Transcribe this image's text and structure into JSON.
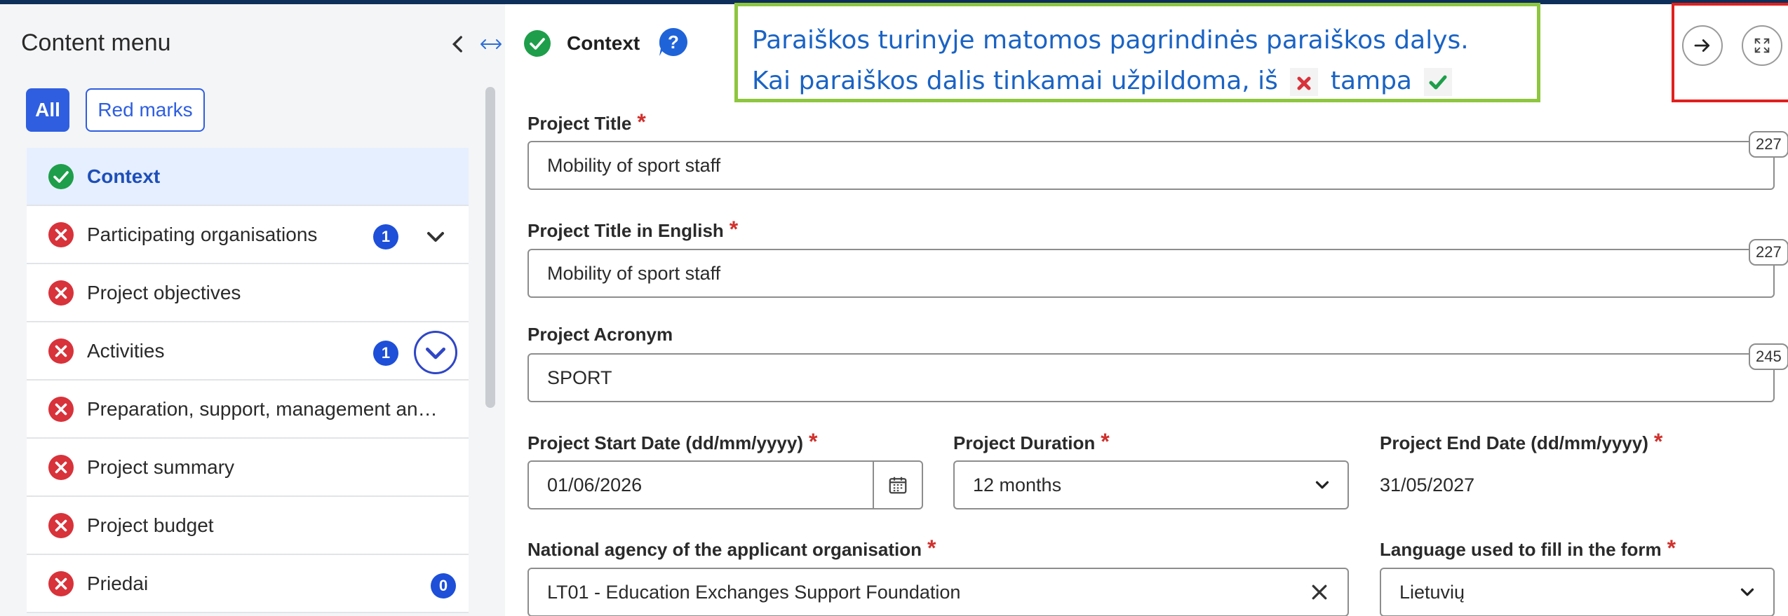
{
  "sidebar": {
    "title": "Content menu",
    "filters": {
      "all": "All",
      "red_marks": "Red marks"
    },
    "items": [
      {
        "label": "Context",
        "status": "complete"
      },
      {
        "label": "Participating organisations",
        "status": "error",
        "badge": "1"
      },
      {
        "label": "Project objectives",
        "status": "error"
      },
      {
        "label": "Activities",
        "status": "error",
        "badge": "1"
      },
      {
        "label": "Preparation, support, management an…",
        "status": "error"
      },
      {
        "label": "Project summary",
        "status": "error"
      },
      {
        "label": "Project budget",
        "status": "error"
      },
      {
        "label": "Priedai",
        "status": "error",
        "badge": "0"
      }
    ]
  },
  "header": {
    "title": "Context"
  },
  "tooltip": {
    "line1": "Paraiškos turinyje matomos pagrindinės paraiškos dalys.",
    "line2_start": "Kai paraiškos dalis tinkamai užpildoma, iš",
    "line2_mid": "tampa"
  },
  "form": {
    "project_title": {
      "label": "Project Title",
      "value": "Mobility of sport staff",
      "counter": "227"
    },
    "project_title_en": {
      "label": "Project Title in English",
      "value": "Mobility of sport staff",
      "counter": "227"
    },
    "project_acronym": {
      "label": "Project Acronym",
      "value": "SPORT",
      "counter": "245"
    },
    "start_date": {
      "label": "Project Start Date (dd/mm/yyyy)",
      "value": "01/06/2026"
    },
    "duration": {
      "label": "Project Duration",
      "value": "12 months"
    },
    "end_date": {
      "label": "Project End Date (dd/mm/yyyy)",
      "value": "31/05/2027"
    },
    "national_agency": {
      "label": "National agency of the applicant organisation",
      "value": "LT01 - Education Exchanges Support Foundation"
    },
    "language": {
      "label": "Language used to fill in the form",
      "value": "Lietuvių"
    }
  },
  "colors": {
    "accent": "#2f5fe0",
    "success": "#1e9e4a",
    "error": "#d8323a",
    "tip_border": "#8ec63f",
    "tip_text": "#1a63c4",
    "highlight_box": "#e0201e"
  }
}
